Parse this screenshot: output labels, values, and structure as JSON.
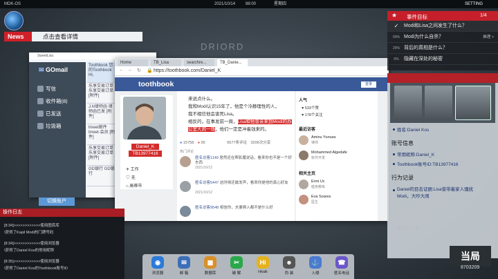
{
  "topbar": {
    "os": "MDK-OS",
    "date": "2021/10/14",
    "time": "88:00",
    "weekday": "星期四",
    "settings": "SETTING"
  },
  "map": {
    "label": "DRIORD"
  },
  "news": {
    "label": "News",
    "text": "点击查看详情"
  },
  "gmail": {
    "window_title": "SweetLisa",
    "logo": "GOmail",
    "nav": [
      {
        "label": "写信"
      },
      {
        "label": "收件箱(8)"
      },
      {
        "label": "已发送"
      },
      {
        "label": "垃圾箱"
      }
    ],
    "switch": "切换账户",
    "mails": [
      {
        "text": "Toothbook 您的Toothbook Hi,"
      },
      {
        "text": "乐享交易订单 乐享交易订单 [附件]"
      },
      {
        "text": "J.N律师函 律师函已发 [附件]"
      },
      {
        "text": "lmeet邮件 lmeet-会员 [附件]"
      },
      {
        "text": "乐享交易订单 乐享交易订单 [附件]"
      },
      {
        "text": "GD银行 GD银行"
      }
    ]
  },
  "browser": {
    "tabs": [
      {
        "label": "Home"
      },
      {
        "label": "TB_Lisa"
      },
      {
        "label": "searchre..."
      },
      {
        "label": "TB_Danie..."
      }
    ],
    "url": "https://toothbook.com/Daniel_K",
    "site_logo": "toothbook",
    "login": "登录",
    "profile": {
      "name": "Daniel_K",
      "id": "TB13977416",
      "work": "工作",
      "status": "无",
      "city": "高蒂市"
    },
    "post": {
      "lines": [
        "来说点什么。",
        "我和Modi认识15年了，他是个冷静理性的人，",
        "我不相信他会害死Lisa。",
        "相反的，在事发前一周，"
      ],
      "highlight": "Lisa和他曾亲来到Modi的办公室大闹一场",
      "after": "，他们一定是冲着钱来的。",
      "likes": "15758",
      "comments": "95",
      "reads": "6577条评论",
      "shares": "3206次分享",
      "comments_label": "热门评论"
    },
    "comments": [
      {
        "user": "匿名访客1149",
        "text": "居然还在帮影魔说话，看来你也不是一个好东西",
        "date": "2021/10/12"
      },
      {
        "user": "匿名访客5447",
        "text": "这时候还敢发声，看来你是他的真心好友",
        "date": "2021/10/12"
      },
      {
        "user": "匿名访客9548",
        "text": "相信你，夫妻俩入都不是什么好",
        "date": ""
      }
    ],
    "right": {
      "popular_label": "人气",
      "likes": "533个赞",
      "follows": "178个关注",
      "visitors_label": "最近访客",
      "visitors": [
        {
          "name": "Aminu Yunusa",
          "role": "律师"
        },
        {
          "name": "Mohammed Algedafe",
          "role": "软件开发"
        }
      ],
      "related_label": "相关主页",
      "related": [
        {
          "name": "Ermi Uc",
          "role": "健身教练"
        },
        {
          "name": "Eva Soares",
          "role": "医生"
        }
      ]
    }
  },
  "oplog": {
    "title": "操作日志",
    "lines": [
      "[8:34]>>>>>>>>>>>>使用图库库",
      "\\获得了Kapil Modi的门牌号码",
      "[8:34]>>>>>>>>>>>>使用浏览器",
      "\\获得了Daniel Kos的常用昵称",
      "[8:35]>>>>>>>>>>>>使用浏览器",
      "\\获得了Daniel Kos的Toothbook账号ID"
    ]
  },
  "dock": [
    {
      "label": "浏览器",
      "color": "#2b7bd8",
      "glyph": "◉"
    },
    {
      "label": "邮 箱",
      "color": "#3d6fb8",
      "glyph": "✉"
    },
    {
      "label": "数据库",
      "color": "#d8902a",
      "glyph": "▦"
    },
    {
      "label": "破 解",
      "color": "#2aa84a",
      "glyph": "✂"
    },
    {
      "label": "Hitalk",
      "color": "#e5b21f",
      "glyph": "Hi"
    },
    {
      "label": "伪 装",
      "color": "#555",
      "glyph": "☻"
    },
    {
      "label": "入侵",
      "color": "#4a7bd0",
      "glyph": "⚓"
    },
    {
      "label": "匿名电话",
      "color": "#6a56c8",
      "glyph": "☎"
    }
  ],
  "events": {
    "title": "事件目标",
    "count": "1/4",
    "items": [
      {
        "pct": "✓",
        "text": "Modi和Lisa之间发生了什么？"
      },
      {
        "pct": "60%",
        "text": "Modi为什么自杀？",
        "extra": "推理 >"
      },
      {
        "pct": "25%",
        "text": "背后的真相是什么？"
      },
      {
        "pct": "0%",
        "text": "隐藏在深处的秘密"
      }
    ]
  },
  "character": {
    "name": "姓名:Daniel Kos",
    "account_title": "账号信息",
    "account_items": [
      "常用昵称:Daniel_K",
      "Toothbook账号ID:TB13977416"
    ],
    "action_title": "行为记录",
    "action_items": [
      "Daniel的目击证据:Lisa曾带着家人骚扰Modi，大吵大闹"
    ],
    "faded": "未识别信息"
  },
  "brand": {
    "logo": "当局",
    "number": "8703209"
  }
}
